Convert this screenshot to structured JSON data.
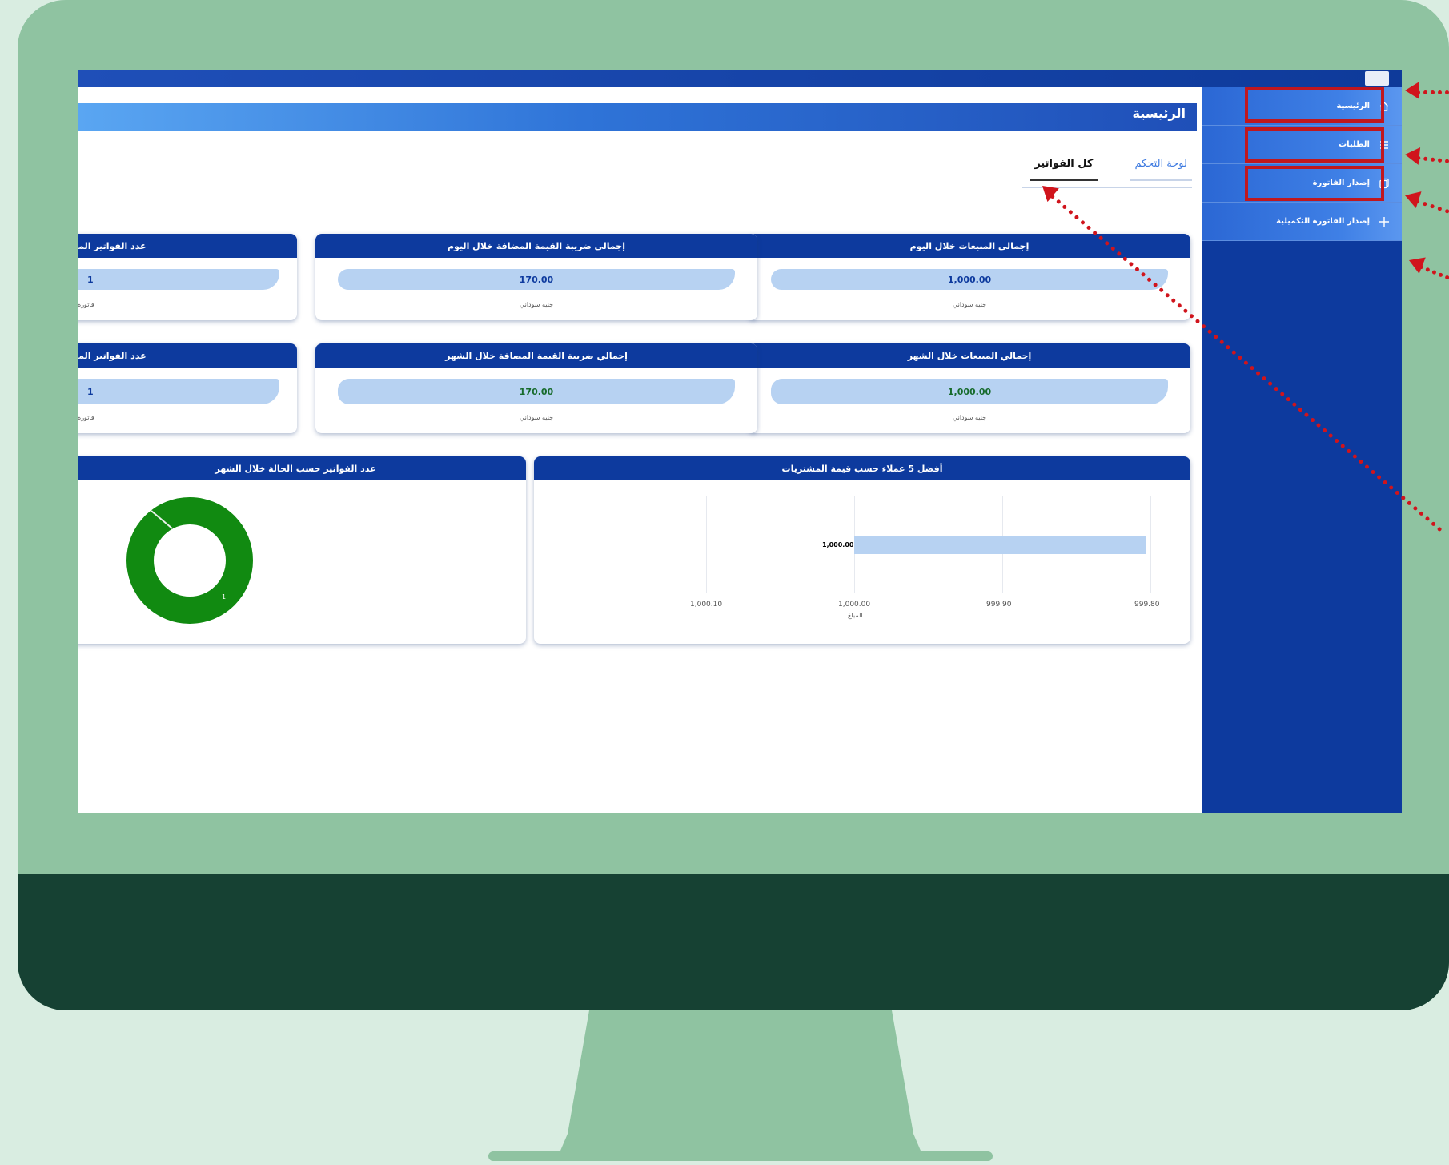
{
  "page": {
    "title": "الرئيسية"
  },
  "tabs": [
    {
      "label": "لوحة التحكم"
    },
    {
      "label": "كل الفواتير"
    }
  ],
  "sidebar": {
    "items": [
      {
        "label": "الرئيسية",
        "icon": "home-icon"
      },
      {
        "label": "الطلبات",
        "icon": "list-icon"
      },
      {
        "label": "إصدار الفاتورة",
        "icon": "copy-icon"
      },
      {
        "label": "إصدار الفاتورة التكميلية",
        "icon": "plus-icon"
      }
    ]
  },
  "cards": {
    "sales_today": {
      "title": "إجمالي المبيعات خلال اليوم",
      "value": "1,000.00",
      "unit": "جنيه سوداني"
    },
    "vat_today": {
      "title": "إجمالي ضريبة القيمة المضافة خلال اليوم",
      "value": "170.00",
      "unit": "جنيه سوداني"
    },
    "invoices_today": {
      "title": "عدد الفواتير المصد",
      "value": "1",
      "unit": "فاتورة"
    },
    "sales_month": {
      "title": "إجمالي المبيعات خلال الشهر",
      "value": "1,000.00",
      "unit": "جنيه سوداني"
    },
    "vat_month": {
      "title": "إجمالي ضريبة القيمة المضافة خلال الشهر",
      "value": "170.00",
      "unit": "جنيه سوداني"
    },
    "invoices_month": {
      "title": "عدد الفواتير المصد",
      "value": "1",
      "unit": "فاتورة"
    }
  },
  "top_customers_chart": {
    "title": "أفضل 5 عملاء حسب قيمة المشتريات",
    "bar_label": "1,000.00",
    "axis_label": "المبلغ"
  },
  "status_chart": {
    "title": "عدد الفواتير حسب الحالة خلال الشهر",
    "slice_label": "1"
  },
  "chart_data": [
    {
      "type": "bar",
      "orientation": "horizontal",
      "title": "أفضل 5 عملاء حسب قيمة المشتريات",
      "xlabel": "المبلغ",
      "x_ticks": [
        "1,000.10",
        "1,000.00",
        "999.90",
        "999.80"
      ],
      "xlim": [
        999.8,
        1000.1
      ],
      "categories": [
        ""
      ],
      "values": [
        1000.0
      ],
      "data_labels": [
        "1,000.00"
      ],
      "colors": {
        "bar": "#b7d2f2"
      }
    },
    {
      "type": "pie",
      "variant": "donut",
      "title": "عدد الفواتير حسب الحالة خلال الشهر",
      "values": [
        1
      ],
      "data_labels": [
        "1"
      ],
      "colors": {
        "slice": "#118a11"
      }
    }
  ],
  "colors": {
    "brand_dark": "#0d3a9e",
    "accent_blue": "#3f7be0",
    "highlight_red": "#c0171e",
    "monitor_green": "#8fc3a1",
    "monitor_chin": "#164133"
  }
}
